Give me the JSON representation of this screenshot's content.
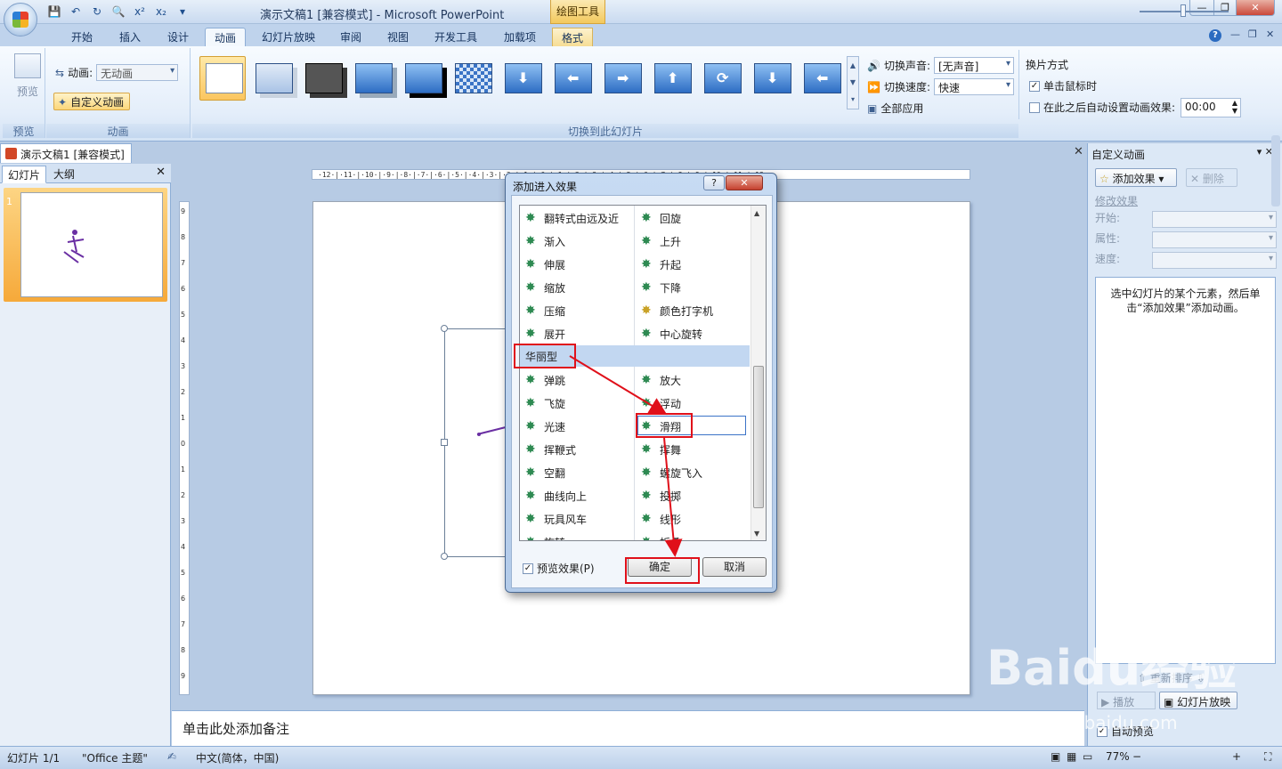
{
  "window": {
    "title": "演示文稿1 [兼容模式] - Microsoft PowerPoint",
    "contextual_tab_group": "绘图工具",
    "controls": [
      "—",
      "❐",
      "✕"
    ]
  },
  "qat_icons": [
    "save-icon",
    "undo-icon",
    "redo-icon",
    "print-preview-icon",
    "superscript-icon",
    "subscript-icon",
    "qat-dropdown-icon"
  ],
  "qat_glyphs": [
    "💾",
    "↶",
    "↻",
    "🔍",
    "x²",
    "x₂",
    "▾"
  ],
  "ribbon_tabs": [
    "开始",
    "插入",
    "设计",
    "动画",
    "幻灯片放映",
    "审阅",
    "视图",
    "开发工具",
    "加载项",
    "格式"
  ],
  "active_tab": "动画",
  "ribbon": {
    "preview_group": {
      "button": "预览",
      "label": "预览"
    },
    "animation_group": {
      "animation_label": "动画:",
      "animation_value": "无动画",
      "custom_button": "自定义动画",
      "label": "动画"
    },
    "transition_group": {
      "label": "切换到此幻灯片",
      "sound_label": "切换声音:",
      "sound_value": "[无声音]",
      "speed_label": "切换速度:",
      "speed_value": "快速",
      "apply_all": "全部应用"
    },
    "advance_group": {
      "title": "换片方式",
      "on_click": "单击鼠标时",
      "on_click_checked": true,
      "auto_after": "在此之后自动设置动画效果:",
      "auto_after_checked": false,
      "time_value": "00:00"
    }
  },
  "document_tab": "演示文稿1 [兼容模式]",
  "left_pane": {
    "tabs": [
      "幻灯片",
      "大纲"
    ],
    "active_tab": "幻灯片",
    "slide_number": "1"
  },
  "ruler": {
    "horizontal": "·12·|·11·|·10·|·9·|·8·|·7·|·6·|·5·|·4·|·3·|·2·|·1·|·0·|·1·|·2·|·3·|·4·|·5·|·6·|·7·|·8·|·9·|·10·|·11·|·12·",
    "vertical": [
      "9",
      "8",
      "7",
      "6",
      "5",
      "4",
      "3",
      "2",
      "1",
      "0",
      "1",
      "2",
      "3",
      "4",
      "5",
      "6",
      "7",
      "8",
      "9"
    ]
  },
  "notes_placeholder": "单击此处添加备注",
  "dialog": {
    "title": "添加进入效果",
    "help": "?",
    "close": "✕",
    "left_column_top": [
      "翻转式由远及近",
      "渐入",
      "伸展",
      "缩放",
      "压缩",
      "展开"
    ],
    "right_column_top": [
      "回旋",
      "上升",
      "升起",
      "下降",
      "颜色打字机",
      "中心旋转"
    ],
    "category": "华丽型",
    "left_column_bottom": [
      "弹跳",
      "飞旋",
      "光速",
      "挥鞭式",
      "空翻",
      "曲线向上",
      "玩具风车",
      "旋转"
    ],
    "right_column_bottom": [
      "放大",
      "浮动",
      "滑翔",
      "挥舞",
      "螺旋飞入",
      "投掷",
      "线形",
      "折叠"
    ],
    "selected_effect": "滑翔",
    "preview_checkbox": "预览效果(P)",
    "preview_checked": true,
    "ok": "确定",
    "cancel": "取消"
  },
  "task_pane": {
    "title": "自定义动画",
    "add_effect": "添加效果",
    "remove": "删除",
    "modify_label": "修改效果",
    "start_label": "开始:",
    "property_label": "属性:",
    "speed_label": "速度:",
    "hint": "选中幻灯片的某个元素，然后单击“添加效果”添加动画。",
    "reorder": "重新排序",
    "play": "播放",
    "slideshow": "幻灯片放映",
    "autopreview": "自动预览",
    "autopreview_checked": true
  },
  "status_bar": {
    "slide": "幻灯片 1/1",
    "theme": "\"Office 主题\"",
    "language": "中文(简体，中国)",
    "zoom": "77%"
  },
  "watermark": {
    "brand": "Baidu经验",
    "url": "jingyan.baidu.com"
  }
}
